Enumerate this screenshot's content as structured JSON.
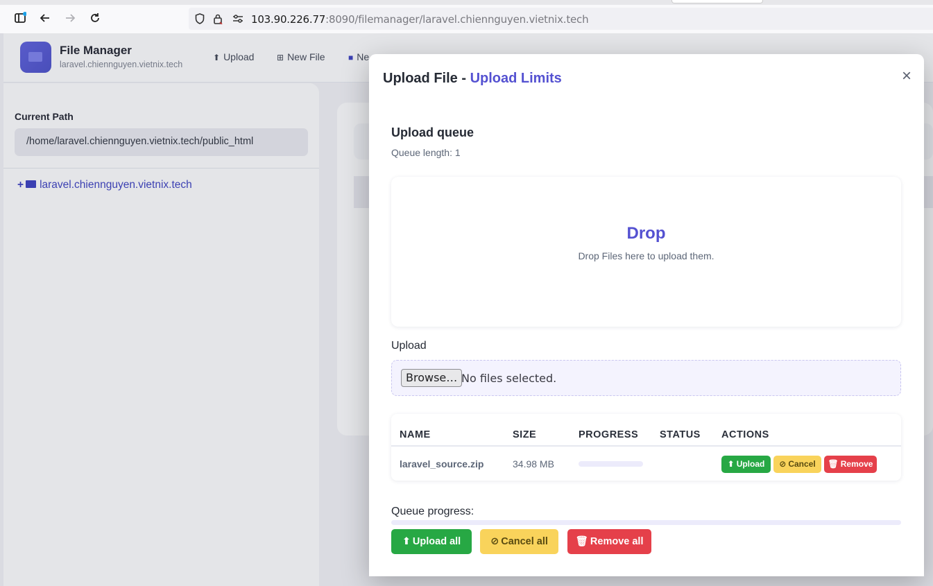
{
  "browser": {
    "url_host": "103.90.226.77",
    "url_rest": ":8090/filemanager/laravel.chiennguyen.vietnix.tech",
    "icons": [
      "sidebar-toggle-icon",
      "back-arrow-icon",
      "forward-arrow-icon",
      "reload-icon",
      "shield-icon",
      "lock-icon",
      "permissions-icon"
    ]
  },
  "app": {
    "title": "File Manager",
    "subtitle": "laravel.chiennguyen.vietnix.tech",
    "toolbar": [
      {
        "label": "Upload",
        "icon": "upload-icon"
      },
      {
        "label": "New File",
        "icon": "plus-square-icon"
      },
      {
        "label": "Ne",
        "icon": "folder-icon"
      }
    ]
  },
  "sidebar": {
    "current_path_label": "Current Path",
    "current_path_value": "/home/laravel.chiennguyen.vietnix.tech/public_html",
    "tree_root": "laravel.chiennguyen.vietnix.tech"
  },
  "modal": {
    "title_prefix": "Upload File - ",
    "title_link": "Upload Limits",
    "close_symbol": "×",
    "queue_title": "Upload queue",
    "queue_length": "Queue length: 1",
    "drop_title": "Drop",
    "drop_subtitle": "Drop Files here to upload them.",
    "upload_label": "Upload",
    "browse_label": "Browse…",
    "file_status": "No files selected.",
    "table": {
      "headers": [
        "NAME",
        "SIZE",
        "PROGRESS",
        "STATUS",
        "ACTIONS"
      ],
      "rows": [
        {
          "name": "laravel_source.zip",
          "size": "34.98 MB",
          "progress": 0,
          "status": ""
        }
      ],
      "row_actions": {
        "upload": "Upload",
        "cancel": "Cancel",
        "remove": "Remove"
      }
    },
    "queue_progress_label": "Queue progress:",
    "queue_progress": 0,
    "buttons": {
      "upload_all": "Upload all",
      "cancel_all": "Cancel all",
      "remove_all": "Remove all"
    }
  },
  "colors": {
    "accent": "#5451d1",
    "success": "#27a844",
    "warning": "#f9d35b",
    "danger": "#e5404a"
  }
}
